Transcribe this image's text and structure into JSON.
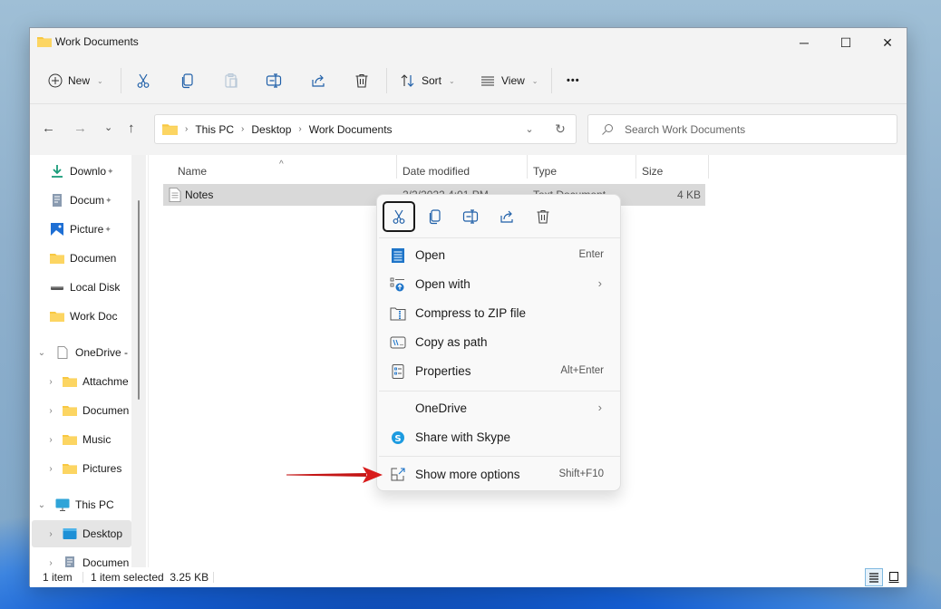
{
  "window": {
    "title": "Work Documents",
    "controls": {
      "minimize": "─",
      "maximize": "☐",
      "close": "✕"
    }
  },
  "toolbar": {
    "new_label": "New",
    "sort_label": "Sort",
    "view_label": "View",
    "more_label": "•••",
    "icons": [
      "cut-icon",
      "copy-icon",
      "paste-icon",
      "rename-icon",
      "share-icon",
      "delete-icon"
    ]
  },
  "navigation": {
    "back": "←",
    "forward": "→",
    "recent": "⌄",
    "up": "↑"
  },
  "address": {
    "breadcrumbs": [
      "This PC",
      "Desktop",
      "Work Documents"
    ],
    "separator": "›"
  },
  "search": {
    "placeholder": "Search Work Documents"
  },
  "sidebar": {
    "items": [
      {
        "label": "Downloads",
        "display": "Downlo",
        "icon": "download-icon",
        "pinned": true
      },
      {
        "label": "Documents",
        "display": "Docum",
        "icon": "documents-icon",
        "pinned": true
      },
      {
        "label": "Pictures",
        "display": "Picture",
        "icon": "pictures-icon",
        "pinned": true
      },
      {
        "label": "Documents",
        "display": "Documen",
        "icon": "folder-icon",
        "pinned": false
      },
      {
        "label": "Local Disk",
        "display": "Local Disk",
        "icon": "drive-icon",
        "pinned": false
      },
      {
        "label": "Work Documents",
        "display": "Work Doc",
        "icon": "folder-icon",
        "pinned": false
      },
      {
        "label": "OneDrive -",
        "display": "OneDrive -",
        "icon": "onedrive-icon",
        "expanded": true
      },
      {
        "label": "Attachments",
        "display": "Attachme",
        "icon": "folder-icon",
        "collapsed": true
      },
      {
        "label": "Documents",
        "display": "Documen",
        "icon": "folder-icon",
        "collapsed": true
      },
      {
        "label": "Music",
        "display": "Music",
        "icon": "folder-icon",
        "collapsed": true
      },
      {
        "label": "Pictures",
        "display": "Pictures",
        "icon": "folder-icon",
        "collapsed": true
      },
      {
        "label": "This PC",
        "display": "This PC",
        "icon": "pc-icon",
        "expanded": true
      },
      {
        "label": "Desktop",
        "display": "Desktop",
        "icon": "desktop-icon",
        "collapsed": true,
        "selected": true
      },
      {
        "label": "Documents",
        "display": "Documen",
        "icon": "documents-icon",
        "collapsed": true
      }
    ],
    "pin_glyph": "📌"
  },
  "file_list": {
    "columns": [
      "Name",
      "Date modified",
      "Type",
      "Size"
    ],
    "sort_indicator": "^",
    "rows": [
      {
        "name": "Notes",
        "date_modified": "2/2/2022 4:01 PM",
        "type": "Text Document",
        "size": "4 KB",
        "selected": true
      }
    ]
  },
  "context_menu": {
    "quick_actions": [
      "cut",
      "copy",
      "rename",
      "share",
      "delete"
    ],
    "items": [
      {
        "label": "Open",
        "shortcut": "Enter",
        "icon": "notepad-icon"
      },
      {
        "label": "Open with",
        "submenu": "›",
        "icon": "open-with-icon"
      },
      {
        "label": "Compress to ZIP file",
        "icon": "zip-icon"
      },
      {
        "label": "Copy as path",
        "icon": "copy-path-icon"
      },
      {
        "label": "Properties",
        "shortcut": "Alt+Enter",
        "icon": "properties-icon"
      },
      {
        "label": "OneDrive",
        "submenu": "›"
      },
      {
        "label": "Share with Skype",
        "icon": "skype-icon"
      },
      {
        "label": "Show more options",
        "shortcut": "Shift+F10",
        "icon": "more-options-icon"
      }
    ]
  },
  "statusbar": {
    "item_count": "1 item",
    "selection": "1 item selected  3.25 KB"
  },
  "colors": {
    "accent": "#0067c0",
    "folder": "#f8c842",
    "annotation_arrow": "#d81b1b",
    "selection": "#d9d9d9"
  }
}
